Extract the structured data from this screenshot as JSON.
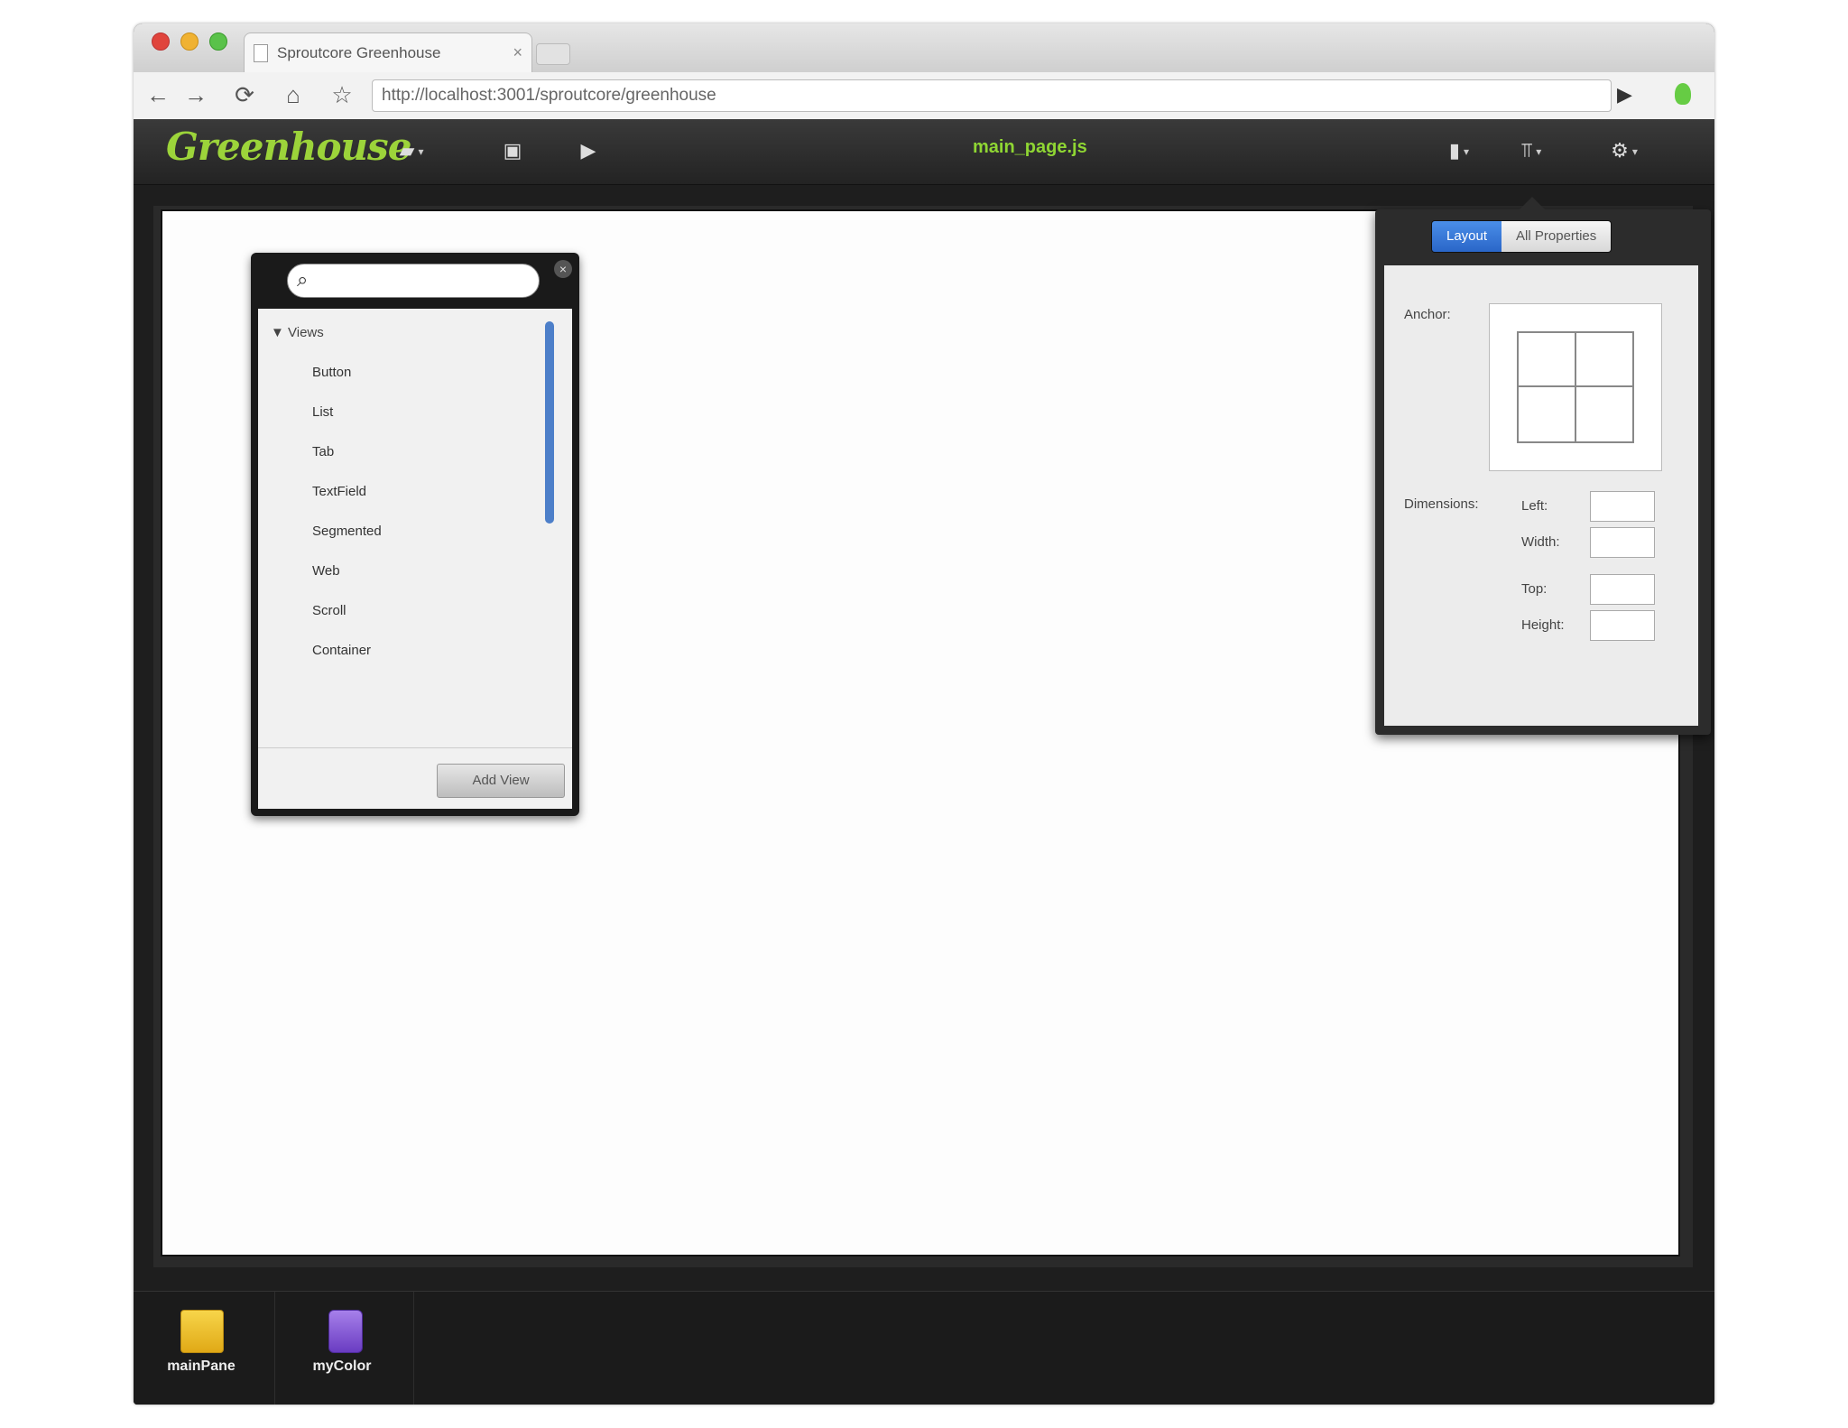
{
  "browser": {
    "tab_title": "Sproutcore Greenhouse",
    "tab_close": "×",
    "url": "http://localhost:3001/sproutcore/greenhouse",
    "nav": {
      "back": "←",
      "forward": "→",
      "reload": "⟳",
      "home": "⌂",
      "star": "☆",
      "go": "▶"
    }
  },
  "app": {
    "logo": "Greenhouse",
    "filename": "main_page.js",
    "toolbar": {
      "folder": "▰",
      "save": "▣",
      "run": "▶",
      "library": "▮",
      "inspector": "⫪",
      "settings": "⚙"
    }
  },
  "library": {
    "search_placeholder": "",
    "close": "×",
    "group_label": "Views",
    "items": [
      "Button",
      "List",
      "Tab",
      "TextField",
      "Segmented",
      "Web",
      "Scroll",
      "Container"
    ],
    "add_button": "Add View"
  },
  "inspector": {
    "tabs": [
      "Layout",
      "All Properties"
    ],
    "selected_tab": "Layout",
    "anchor_label": "Anchor:",
    "dimensions_label": "Dimensions:",
    "fields": [
      {
        "label": "Left:",
        "value": ""
      },
      {
        "label": "Width:",
        "value": ""
      },
      {
        "label": "Top:",
        "value": ""
      },
      {
        "label": "Height:",
        "value": ""
      }
    ]
  },
  "dock": {
    "items": [
      {
        "name": "mainPane",
        "icon": "pane-icon",
        "color": "#f2c11f"
      },
      {
        "name": "myColor",
        "icon": "color-jar-icon",
        "color": "#8a5bd6"
      }
    ]
  },
  "colors": {
    "accent_green": "#8fd633",
    "selected_blue": "#2a66c8"
  }
}
